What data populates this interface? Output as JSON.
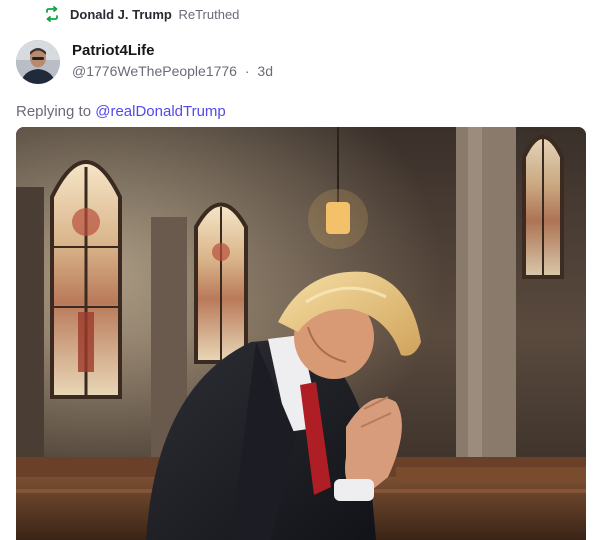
{
  "retruth": {
    "user_name": "Donald J. Trump",
    "action_label": "ReTruthed",
    "icon": "retruth-icon",
    "icon_color": "#16a34a"
  },
  "post": {
    "author": {
      "display_name": "Patriot4Life",
      "handle": "@1776WeThePeople1776",
      "separator": "·",
      "time_ago": "3d",
      "avatar": "avatar-photo"
    },
    "reply": {
      "prefix": "Replying to",
      "mention": "@realDonaldTrump",
      "mention_color": "#5448ee"
    },
    "media": {
      "type": "image",
      "subject": "man in dark suit praying in a church pew near stained-glass windows"
    }
  }
}
